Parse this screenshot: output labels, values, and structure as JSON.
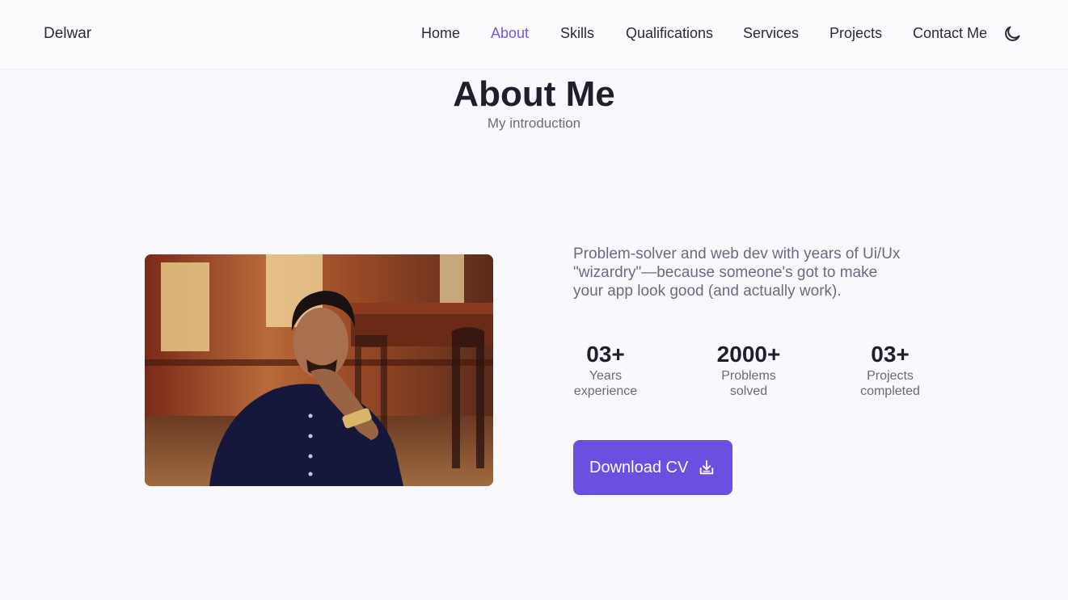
{
  "header": {
    "logo": "Delwar",
    "nav": [
      {
        "label": "Home",
        "active": false
      },
      {
        "label": "About",
        "active": true
      },
      {
        "label": "Skills",
        "active": false
      },
      {
        "label": "Qualifications",
        "active": false
      },
      {
        "label": "Services",
        "active": false
      },
      {
        "label": "Projects",
        "active": false
      },
      {
        "label": "Contact Me",
        "active": false
      }
    ],
    "theme_toggle_icon": "moon-icon"
  },
  "section": {
    "title": "About Me",
    "subtitle": "My introduction"
  },
  "about": {
    "photo_icon": "profile-photo",
    "description_lines": [
      "Problem-solver and web dev with years of Ui/Ux",
      "\"wizardry\"—because someone's got to make",
      "your app look good (and actually work)."
    ],
    "stats": [
      {
        "value": "03+",
        "label_line1": "Years",
        "label_line2": "experience"
      },
      {
        "value": "2000+",
        "label_line1": "Problems",
        "label_line2": "solved"
      },
      {
        "value": "03+",
        "label_line1": "Projects",
        "label_line2": "completed"
      }
    ],
    "download_button": {
      "label": "Download CV",
      "icon": "download-icon"
    }
  },
  "colors": {
    "accent": "#6a4fe0",
    "active_nav": "#7058e0",
    "background": "#f9f8fd"
  }
}
